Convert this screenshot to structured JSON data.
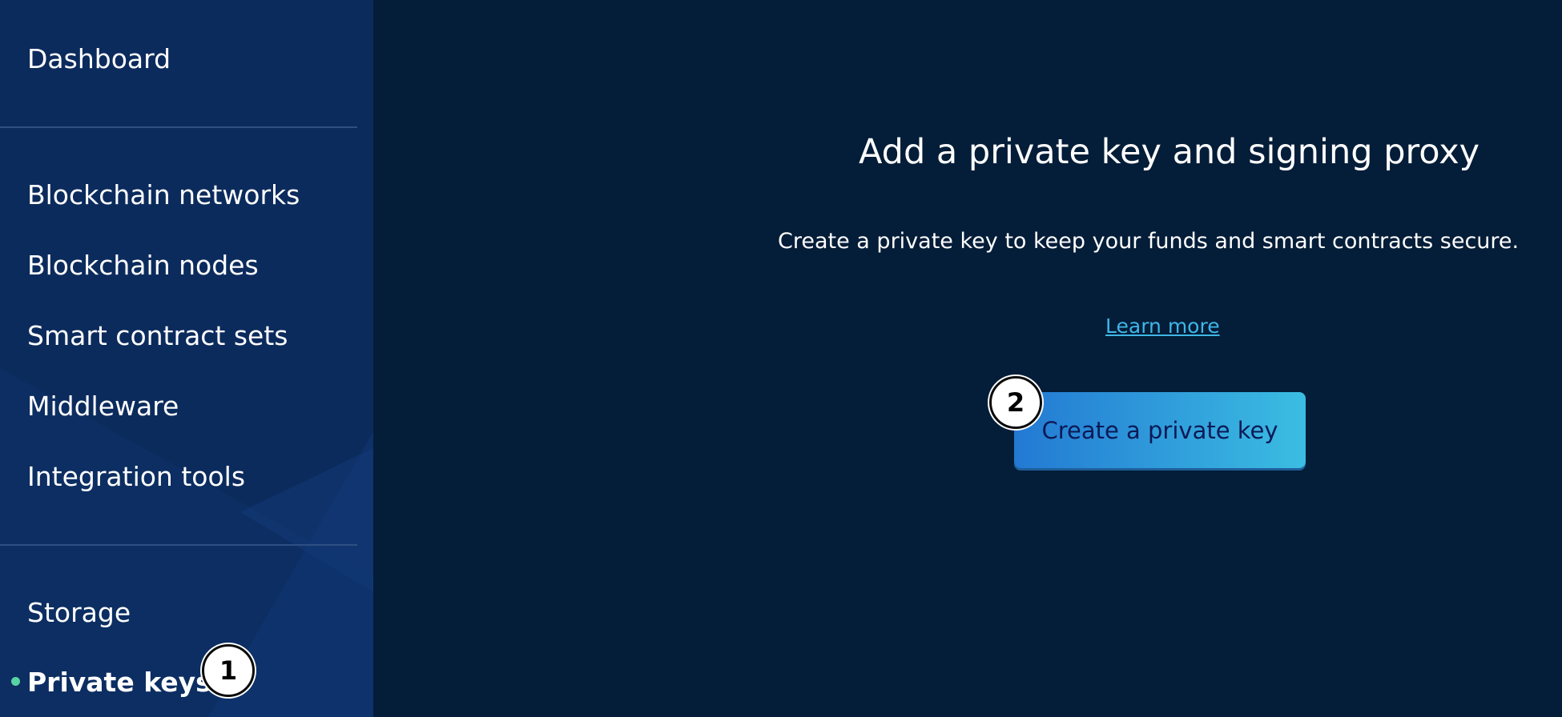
{
  "sidebar": {
    "items": [
      {
        "label": "Dashboard"
      },
      {
        "label": "Blockchain networks"
      },
      {
        "label": "Blockchain nodes"
      },
      {
        "label": "Smart contract sets"
      },
      {
        "label": "Middleware"
      },
      {
        "label": "Integration tools"
      },
      {
        "label": "Storage"
      },
      {
        "label": "Private keys",
        "active": true
      }
    ]
  },
  "main": {
    "title": "Add a private key and signing proxy",
    "subtitle": "Create a private key to keep your funds and smart contracts secure.",
    "learn_more": "Learn more",
    "create_button": "Create a private key"
  },
  "steps": [
    {
      "number": "1"
    },
    {
      "number": "2"
    }
  ],
  "colors": {
    "background": "#041d38",
    "sidebar": "#0c2b5d",
    "link": "#3fb6e8",
    "button_gradient_start": "#2379d3",
    "button_gradient_end": "#3bbde2",
    "active_indicator": "#58d3a4"
  }
}
